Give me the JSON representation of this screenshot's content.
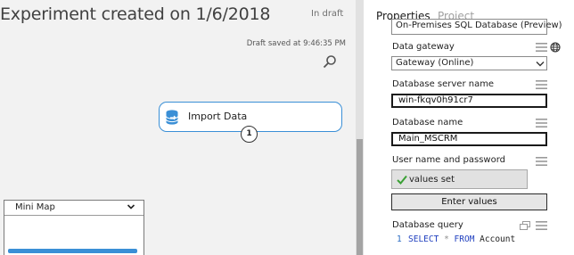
{
  "canvas": {
    "title": "Experiment created on 1/6/2018",
    "status": "In draft",
    "draft_saved": "Draft saved at 9:46:35 PM",
    "module": {
      "label": "Import Data",
      "port_number": "1"
    },
    "minimap": {
      "title": "Mini Map"
    }
  },
  "panel": {
    "tabs": [
      "Properties",
      "Project"
    ],
    "db_type_value": "On-Premises SQL Database (Preview)",
    "fields": {
      "data_gateway": {
        "label": "Data gateway",
        "value": "Gateway (Online)"
      },
      "server_name": {
        "label": "Database server name",
        "value": "win-fkqv0h91cr7"
      },
      "database_name": {
        "label": "Database name",
        "value": "Main_MSCRM"
      },
      "credentials": {
        "label": "User name and password",
        "status": "values set",
        "button": "Enter values"
      },
      "query": {
        "label": "Database query",
        "line_number": "1",
        "kw_select": "SELECT",
        "op_star": "*",
        "kw_from": "FROM",
        "table": "Account"
      }
    }
  },
  "icons": [
    "search-icon",
    "database-icon",
    "chevron-down-icon",
    "menu-lines-icon",
    "globe-icon",
    "checkmark-icon",
    "copy-icon"
  ],
  "colors": {
    "accent": "#3a8fd6",
    "canvas_bg": "#f2f2f2",
    "keyword": "#1f3fbf"
  }
}
